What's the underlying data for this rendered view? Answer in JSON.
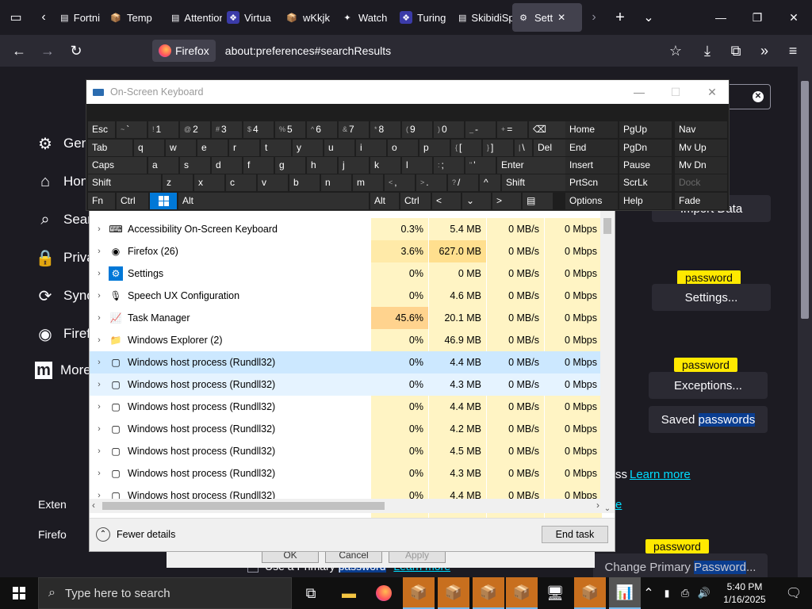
{
  "browser": {
    "tabs": [
      {
        "label": "Fortni",
        "icon": "page-icon"
      },
      {
        "label": "Temp",
        "icon": "package-icon"
      },
      {
        "label": "Attention",
        "icon": "page-icon"
      },
      {
        "label": "Virtua",
        "icon": "code-icon"
      },
      {
        "label": "wKkjk",
        "icon": "package-icon"
      },
      {
        "label": "Watch",
        "icon": "spark-icon"
      },
      {
        "label": "Turing",
        "icon": "code-icon"
      },
      {
        "label": "SkibidiSpo",
        "icon": "page-icon"
      },
      {
        "label": "Sett",
        "icon": "gear-icon",
        "active": true
      }
    ],
    "identity_label": "Firefox",
    "url": "about:preferences#searchResults"
  },
  "prefs": {
    "sidebar": [
      {
        "label": "Gen",
        "icon": "gear-icon"
      },
      {
        "label": "Hon",
        "icon": "home-icon"
      },
      {
        "label": "Sear",
        "icon": "search-icon"
      },
      {
        "label": "Priva",
        "icon": "lock-icon"
      },
      {
        "label": "Sync",
        "icon": "sync-icon"
      },
      {
        "label": "Firef",
        "icon": "firefox-icon"
      },
      {
        "label": "More",
        "icon": "mozilla-icon"
      }
    ],
    "sidebar_bottom": [
      "Exten",
      "Firefo"
    ],
    "import_btn_prefix": "I",
    "import_btn_rest": "mport Data",
    "highlight_label": "password",
    "settings_btn": "Settings...",
    "exceptions_btn": "Exceptions...",
    "saved_btn_pre": "Saved ",
    "saved_btn_hl": "passwords",
    "learn_more": "Learn more",
    "learn_more_2": "e",
    "ss_fragment": "ss",
    "use_primary_pre": "Use a Primary ",
    "use_primary_hl": "password",
    "use_primary_learn": "Learn more",
    "change_primary_pre": "Change Primary ",
    "change_primary_hl": "Password",
    "change_primary_post": "..."
  },
  "dialog_ghost": {
    "ok": "OK",
    "cancel": "Cancel",
    "apply": "Apply"
  },
  "taskmanager": {
    "rows": [
      {
        "name": "Accessibility On-Screen Keyboard",
        "icon": "keyboard-icon",
        "cpu": "0.3%",
        "mem": "5.4 MB",
        "disk": "0 MB/s",
        "net": "0 Mbps"
      },
      {
        "name": "Firefox (26)",
        "icon": "firefox-icon",
        "cpu": "3.6%",
        "mem": "627.0 MB",
        "disk": "0 MB/s",
        "net": "0 Mbps"
      },
      {
        "name": "Settings",
        "icon": "gear-icon",
        "cpu": "0%",
        "mem": "0 MB",
        "disk": "0 MB/s",
        "net": "0 Mbps"
      },
      {
        "name": "Speech UX Configuration",
        "icon": "microphone-icon",
        "cpu": "0%",
        "mem": "4.6 MB",
        "disk": "0 MB/s",
        "net": "0 Mbps"
      },
      {
        "name": "Task Manager",
        "icon": "taskmanager-icon",
        "cpu": "45.6%",
        "mem": "20.1 MB",
        "disk": "0 MB/s",
        "net": "0 Mbps"
      },
      {
        "name": "Windows Explorer (2)",
        "icon": "folder-icon",
        "cpu": "0%",
        "mem": "46.9 MB",
        "disk": "0 MB/s",
        "net": "0 Mbps"
      },
      {
        "name": "Windows host process (Rundll32)",
        "icon": "window-icon",
        "cpu": "0%",
        "mem": "4.4 MB",
        "disk": "0 MB/s",
        "net": "0 Mbps"
      },
      {
        "name": "Windows host process (Rundll32)",
        "icon": "window-icon",
        "cpu": "0%",
        "mem": "4.3 MB",
        "disk": "0 MB/s",
        "net": "0 Mbps"
      },
      {
        "name": "Windows host process (Rundll32)",
        "icon": "window-icon",
        "cpu": "0%",
        "mem": "4.4 MB",
        "disk": "0 MB/s",
        "net": "0 Mbps"
      },
      {
        "name": "Windows host process (Rundll32)",
        "icon": "window-icon",
        "cpu": "0%",
        "mem": "4.2 MB",
        "disk": "0 MB/s",
        "net": "0 Mbps"
      },
      {
        "name": "Windows host process (Rundll32)",
        "icon": "window-icon",
        "cpu": "0%",
        "mem": "4.5 MB",
        "disk": "0 MB/s",
        "net": "0 Mbps"
      },
      {
        "name": "Windows host process (Rundll32)",
        "icon": "window-icon",
        "cpu": "0%",
        "mem": "4.3 MB",
        "disk": "0 MB/s",
        "net": "0 Mbps"
      },
      {
        "name": "Windows host process (Rundll32)",
        "icon": "window-icon",
        "cpu": "0%",
        "mem": "4.4 MB",
        "disk": "0 MB/s",
        "net": "0 Mbps"
      }
    ],
    "fewer_details": "Fewer details",
    "end_task": "End task"
  },
  "osk": {
    "title": "On-Screen Keyboard"
  },
  "taskbar": {
    "search_placeholder": "Type here to search",
    "time": "5:40 PM",
    "date": "1/16/2025"
  },
  "colors": {
    "accent_yellow": "#ffe900",
    "cpu_high": "#ffd38e",
    "mem_high": "#ffdf8e",
    "cell_light": "#fff4c4",
    "selection": "#cce8ff",
    "osk_blue": "#0078d7"
  }
}
